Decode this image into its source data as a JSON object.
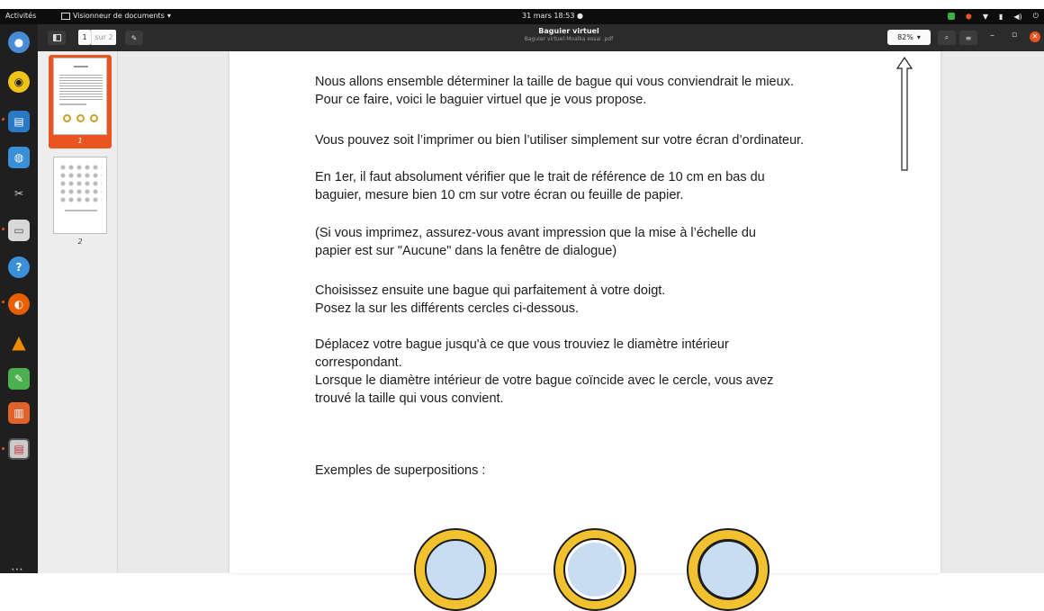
{
  "topbar": {
    "activities": "Activités",
    "app_name": "Visionneur de documents",
    "clock": "31 mars  18:53"
  },
  "dock": {
    "items": [
      "ubuntu-dock-icon",
      "rhythmbox-icon",
      "libreoffice-writer-icon",
      "software-center-icon",
      "screenshot-icon",
      "files-icon",
      "help-icon",
      "firefox-icon",
      "vlc-icon",
      "image-editor-icon",
      "libreoffice-impress-icon",
      "document-viewer-icon"
    ],
    "show_apps": "⋯"
  },
  "header": {
    "current_page": "1",
    "page_total": "sur 2",
    "title": "Baguier virtuel",
    "subtitle": "Baguier virtuel-Moalka essai .pdf",
    "zoom": "82%"
  },
  "sidebar": {
    "thumbnails": [
      {
        "label": "1"
      },
      {
        "label": "2"
      }
    ]
  },
  "document": {
    "paragraphs": [
      "Nous allons ensemble déterminer la taille de bague qui vous conviendrait le mieux.\nPour ce faire, voici le baguier virtuel que je vous propose.",
      "Vous pouvez soit l’imprimer ou bien l’utiliser simplement sur votre écran d’ordinateur.",
      "En 1er, il faut absolument vérifier que le trait de référence de 10 cm en bas du\nbaguier,  mesure bien 10 cm sur votre écran ou feuille de papier.",
      " (Si vous imprimez,  assurez-vous avant impression  que la mise à l’échelle du\npapier est sur \"Aucune\" dans la fenêtre de dialogue)",
      "Choisissez ensuite une bague qui parfaitement à votre doigt.\nPosez la sur les différents cercles ci-dessous.",
      "Déplacez votre bague jusqu'à ce que vous trouviez le diamètre intérieur\ncorrespondant.\nLorsque le diamètre intérieur de votre bague coïncide avec le cercle, vous avez\ntrouvé la taille qui vous convient.",
      "Exemples de superpositions :"
    ]
  },
  "colors": {
    "accent": "#e95420",
    "ring_gold": "#f2c12e",
    "ring_fill": "#c8dcf2"
  }
}
